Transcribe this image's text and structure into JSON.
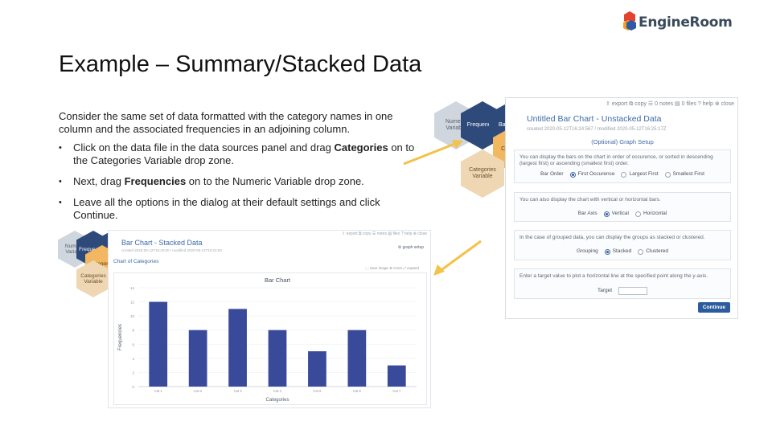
{
  "logo": {
    "text": "EngineRoom"
  },
  "slide": {
    "title": "Example – Summary/Stacked Data",
    "intro": "Consider the same set of data formatted with the category names in one column and the associated frequencies in an adjoining column.",
    "bullets": [
      {
        "before": "Click on the data file in the data sources panel and drag ",
        "bold": "Categories",
        "after": " on to the Categories Variable drop zone."
      },
      {
        "before": "Next, drag ",
        "bold": "Frequencies",
        "after": " on to the Numeric Variable drop zone."
      },
      {
        "before": "Leave all the options in the dialog at their default settings and click Continue.",
        "bold": "",
        "after": ""
      }
    ]
  },
  "hexes": {
    "numeric": "Numeric Variable",
    "frequencies": "Frequencies",
    "bar_chart": "Bar Chart",
    "categories": "Categories",
    "categories_variable": "Categories Variable"
  },
  "dialog": {
    "toolbar": "⇪ export  ⧉ copy  ☰ 0 notes  ▤ 0 files  ? help  ⊗ close",
    "title": "Untitled Bar Chart - Unstacked Data",
    "meta": "created 2020-05-12T16:24:567 / modified 2020-05-12T16:25:17Z",
    "section": "(Optional) Graph Setup",
    "cards": [
      {
        "text": "You can display the bars on the chart in order of occurence, or sorted in descending (largest first) or ascending (smallest first) order.",
        "label": "Bar Order",
        "options": [
          "First Occurence",
          "Largest First",
          "Smallest First"
        ],
        "selected": 0
      },
      {
        "text": "You can also display the chart with vertical or horizontal bars.",
        "label": "Bar Axis",
        "options": [
          "Vertical",
          "Horizontal"
        ],
        "selected": 0
      },
      {
        "text": "In the case of grouped data, you can display the groups as stacked or clustered.",
        "label": "Grouping",
        "options": [
          "Stacked",
          "Clustered"
        ],
        "selected": 0
      },
      {
        "text": "Enter a target value to plot a horizontal line at the specified point along the y-axis.",
        "label": "Target"
      }
    ],
    "continue_label": "Continue"
  },
  "shot": {
    "toolbar": "⇪ export  ⧉ copy  ☰ notes  ▤ files  ? help  ⊗ close",
    "title": "Bar Chart - Stacked Data",
    "meta": "created 2020-05-12T16:20:00 / modified 2020-05-12T16:24:00",
    "graph_setup": "⚙ graph setup",
    "link": "Chart of Categories",
    "tools": "⬚ save image   ⊕ zoom   ⤢ expand"
  },
  "chart_data": {
    "type": "bar",
    "title": "Bar Chart",
    "xlabel": "Categories",
    "ylabel": "Frequencies",
    "categories": [
      "Cat 1",
      "Cat 2",
      "Cat 3",
      "Cat 4",
      "Cat 5",
      "Cat 6",
      "Cat 7"
    ],
    "values": [
      12,
      8,
      11,
      8,
      5,
      8,
      3
    ],
    "yticks": [
      0,
      2,
      4,
      6,
      8,
      10,
      12,
      14
    ],
    "ylim": [
      0,
      14
    ],
    "bar_color": "#3a4a9a"
  },
  "colors": {
    "accent": "#3f6aa8",
    "arrow": "#f2c24a",
    "button": "#2d5c9e"
  }
}
